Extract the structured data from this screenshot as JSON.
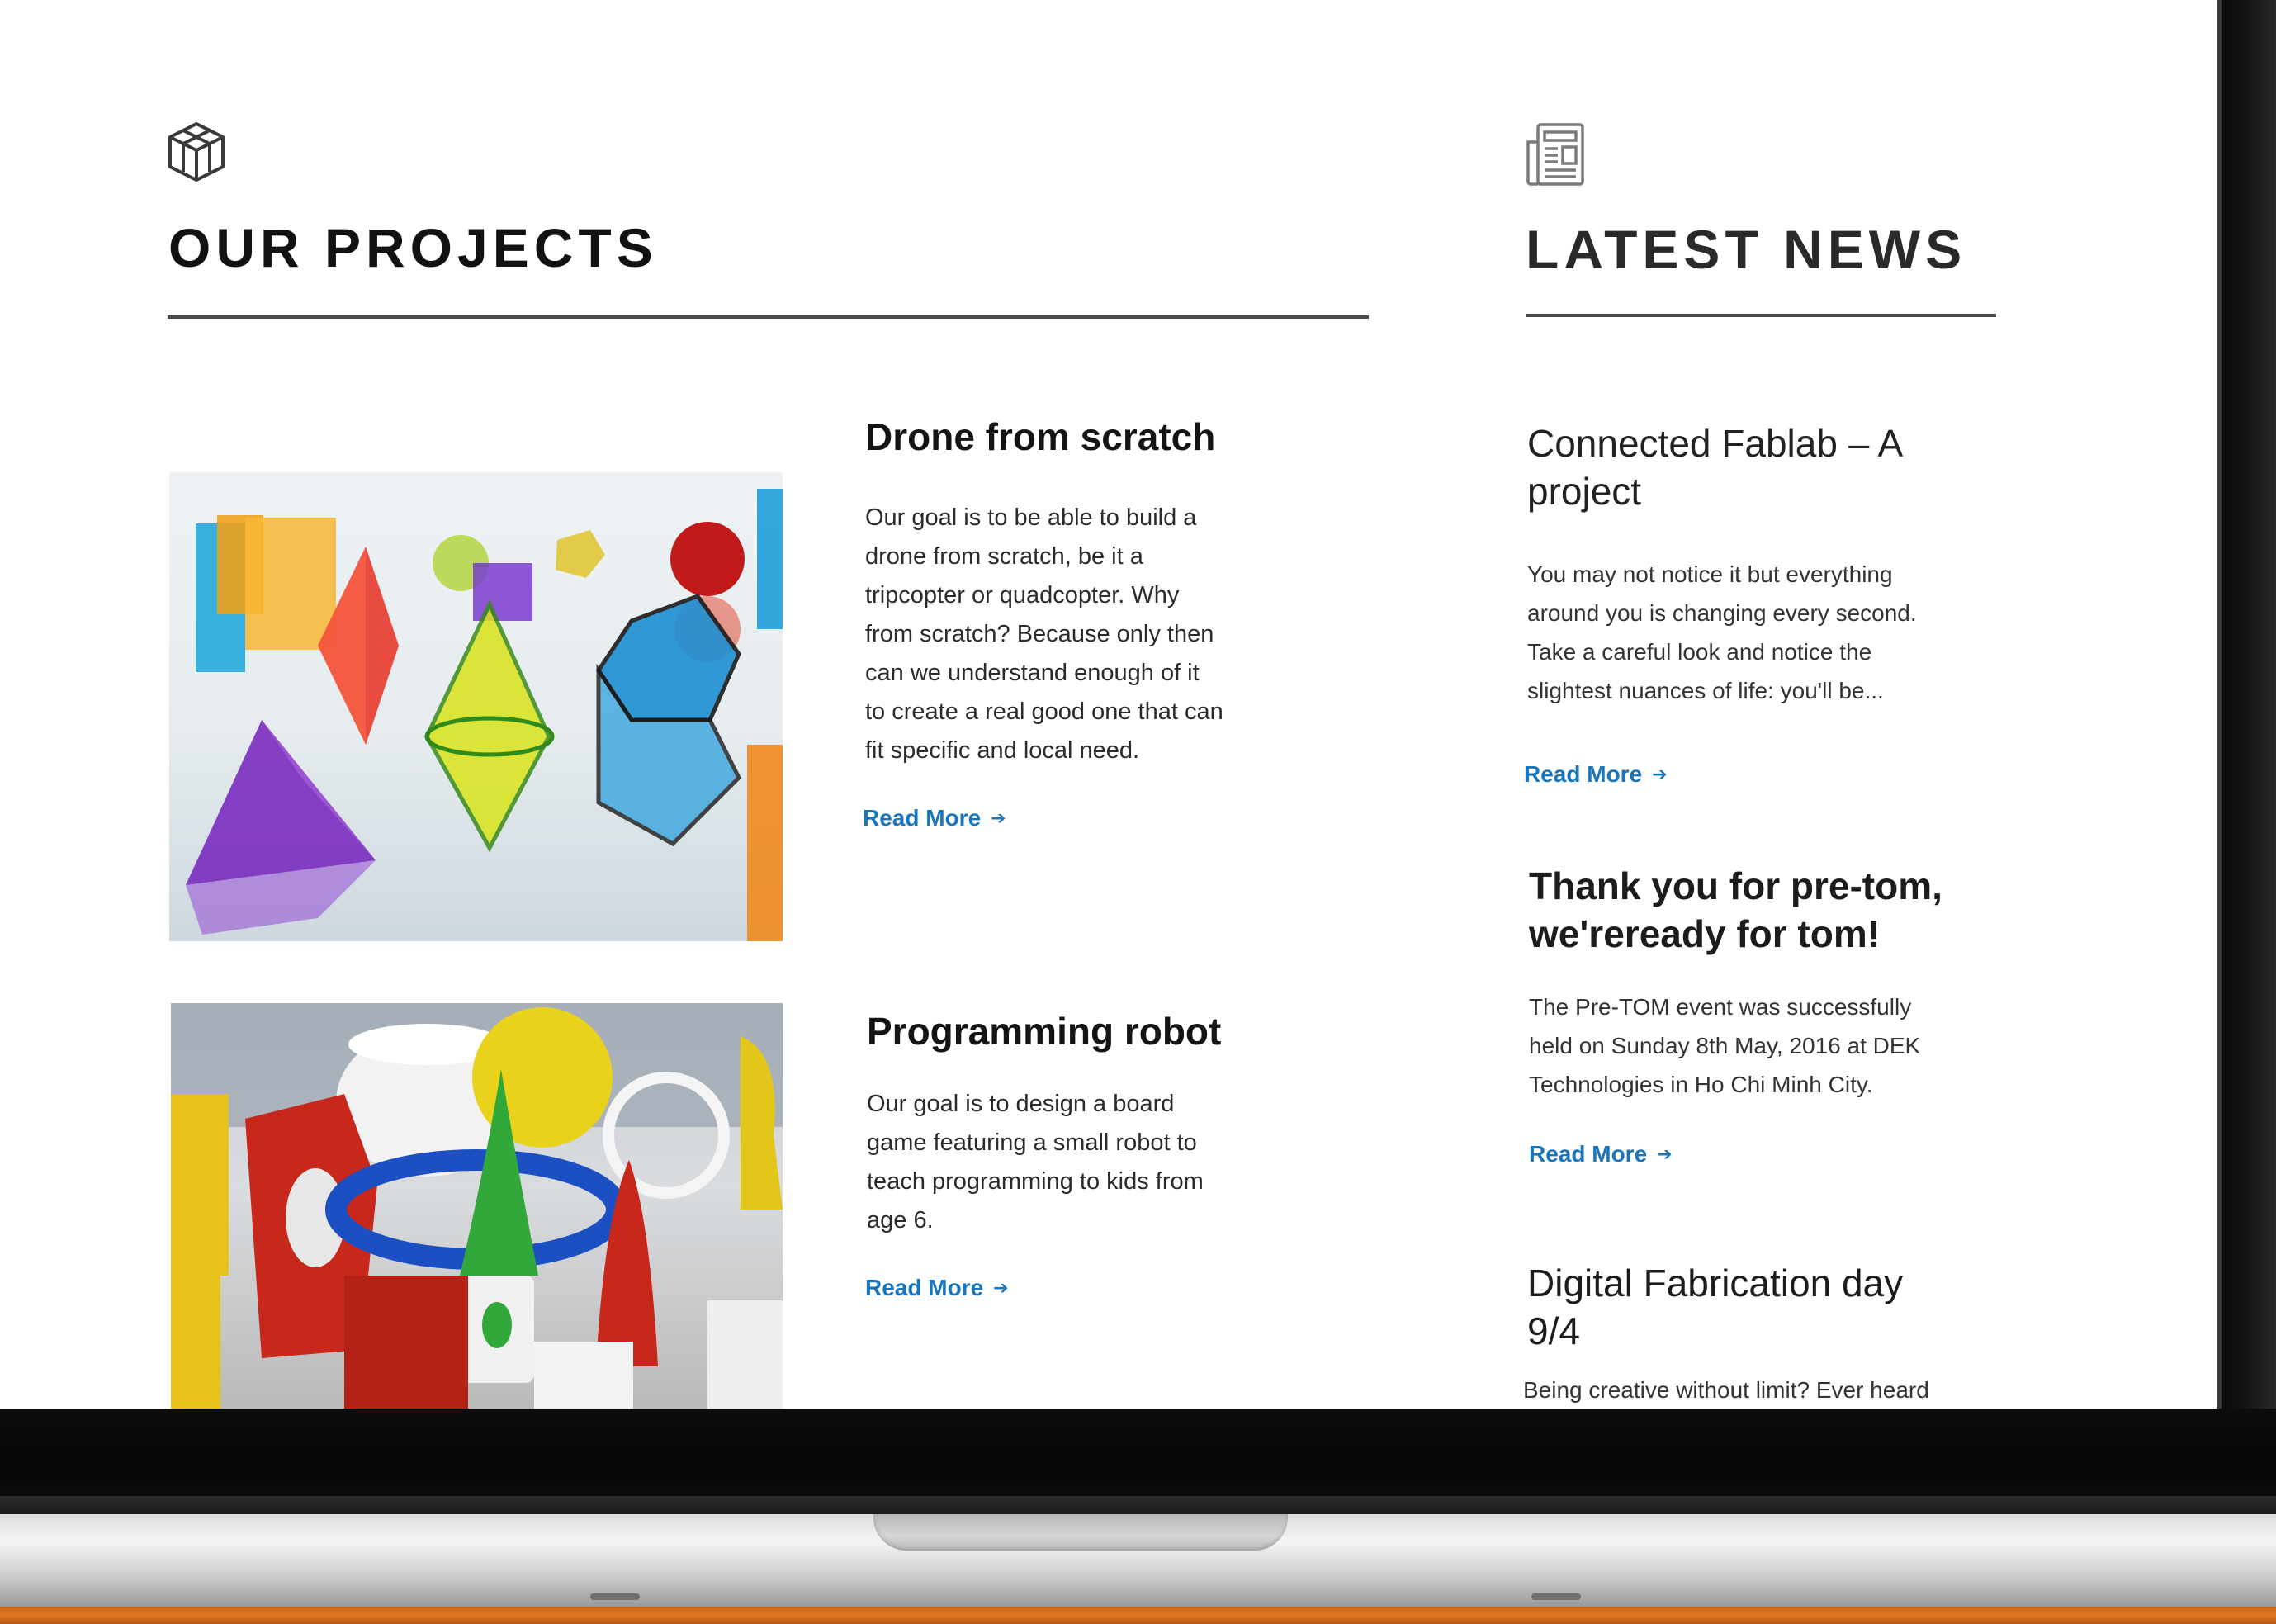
{
  "sections": {
    "projects": {
      "title": "OUR PROJECTS",
      "icon": "cube-icon"
    },
    "news": {
      "title": "LATEST NEWS",
      "icon": "newspaper-icon"
    }
  },
  "projects": [
    {
      "title": "Drone from scratch",
      "description": "Our goal is to be able to build a\ndrone from scratch, be it a\ntripcopter or quadcopter. Why\nfrom scratch? Because only then\ncan we understand enough of it\nto create a real good one that can\nfit specific and local need.",
      "read_more": "Read More",
      "image": "colorful-geometric-shapes-image"
    },
    {
      "title": "Programming robot",
      "description": "Our goal is to design a board\ngame featuring a small robot to\nteach programming to kids from\nage 6.",
      "read_more": "Read More",
      "image": "3d-printed-objects-image"
    }
  ],
  "news": [
    {
      "title": "Connected Fablab – A\nproject",
      "description": "You may not notice it but everything\naround you is changing every second.\nTake a careful look and notice the\nslightest nuances of life: you'll be...",
      "read_more": "Read More"
    },
    {
      "title": "Thank you for pre-tom,\nwe'reready for tom!",
      "description": "The Pre-TOM event was successfully\nheld on Sunday 8th May, 2016 at DEK\nTechnologies in Ho Chi Minh City.",
      "read_more": "Read More"
    },
    {
      "title": "Digital Fabrication day\n9/4",
      "description": "Being creative without limit? Ever heard"
    }
  ],
  "colors": {
    "link": "#1b75bb",
    "heading": "#121212",
    "rule": "#4a4a4a"
  }
}
